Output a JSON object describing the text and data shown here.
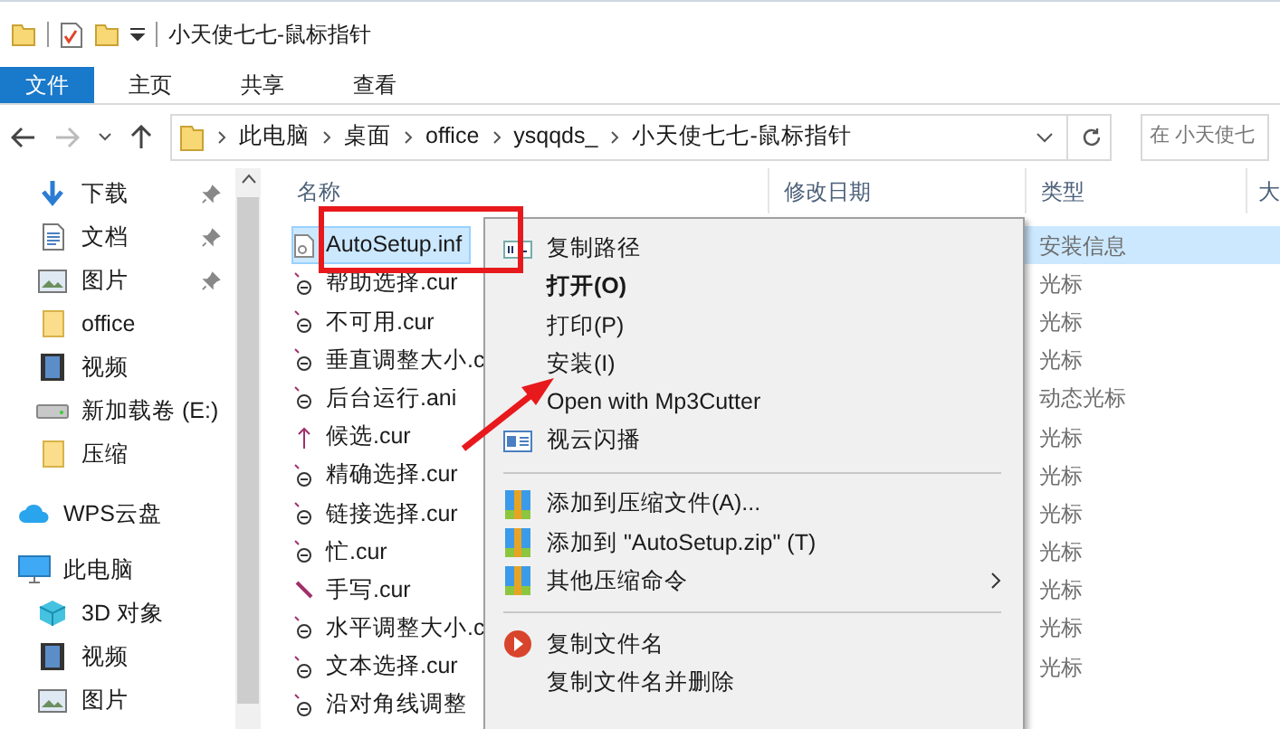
{
  "window": {
    "title": "小天使七七-鼠标指针"
  },
  "ribbon_tabs": [
    {
      "label": "文件",
      "selected": true
    },
    {
      "label": "主页",
      "selected": false
    },
    {
      "label": "共享",
      "selected": false
    },
    {
      "label": "查看",
      "selected": false
    }
  ],
  "address_bar": {
    "breadcrumbs": [
      "此电脑",
      "桌面",
      "office",
      "ysqqds_",
      "小天使七七-鼠标指针"
    ],
    "search_placeholder": "在 小天使七"
  },
  "sidebar": {
    "quick_access": [
      {
        "label": "下载",
        "kind": "download",
        "pinned": true
      },
      {
        "label": "文档",
        "kind": "document",
        "pinned": true
      },
      {
        "label": "图片",
        "kind": "picture",
        "pinned": true
      },
      {
        "label": "office",
        "kind": "folder",
        "pinned": false
      },
      {
        "label": "视频",
        "kind": "video",
        "pinned": false
      },
      {
        "label": "新加载卷 (E:)",
        "kind": "drive",
        "pinned": false
      },
      {
        "label": "压缩",
        "kind": "folder",
        "pinned": false
      }
    ],
    "tree": [
      {
        "label": "WPS云盘",
        "kind": "cloud"
      },
      {
        "label": "此电脑",
        "kind": "pc",
        "children": [
          {
            "label": "3D 对象",
            "kind": "cube"
          },
          {
            "label": "视频",
            "kind": "video"
          },
          {
            "label": "图片",
            "kind": "picture"
          }
        ]
      }
    ]
  },
  "file_list": {
    "columns": [
      "名称",
      "修改日期",
      "类型",
      "大"
    ],
    "rows": [
      {
        "name": "AutoSetup.inf",
        "kind": "setup",
        "type": "安装信息",
        "selected": true
      },
      {
        "name": "帮助选择.cur",
        "kind": "cursor",
        "type": "光标",
        "selected": false
      },
      {
        "name": "不可用.cur",
        "kind": "cursor",
        "type": "光标",
        "selected": false
      },
      {
        "name": "垂直调整大小.c",
        "kind": "cursor",
        "type": "光标",
        "selected": false
      },
      {
        "name": "后台运行.ani",
        "kind": "cursor",
        "type": "动态光标",
        "selected": false
      },
      {
        "name": "候选.cur",
        "kind": "arrow",
        "type": "光标",
        "selected": false
      },
      {
        "name": "精确选择.cur",
        "kind": "cursor",
        "type": "光标",
        "selected": false
      },
      {
        "name": "链接选择.cur",
        "kind": "cursor",
        "type": "光标",
        "selected": false
      },
      {
        "name": "忙.cur",
        "kind": "cursor",
        "type": "光标",
        "selected": false
      },
      {
        "name": "手写.cur",
        "kind": "pen",
        "type": "光标",
        "selected": false
      },
      {
        "name": "水平调整大小.c",
        "kind": "cursor",
        "type": "光标",
        "selected": false
      },
      {
        "name": "文本选择.cur",
        "kind": "cursor",
        "type": "光标",
        "selected": false
      },
      {
        "name": "沿对角线调整",
        "kind": "cursor",
        "selected": false
      }
    ]
  },
  "context_menu": {
    "items": [
      {
        "kind": "path",
        "label": "复制路径",
        "default": false,
        "submenu": false
      },
      {
        "kind": "plain",
        "label": "打开(O)",
        "default": true,
        "submenu": false
      },
      {
        "kind": "plain",
        "label": "打印(P)",
        "default": false,
        "submenu": false
      },
      {
        "kind": "plain",
        "label": "安装(I)",
        "default": false,
        "submenu": false
      },
      {
        "kind": "plain",
        "label": "Open with Mp3Cutter",
        "default": false,
        "submenu": false
      },
      {
        "kind": "window",
        "label": "视云闪播",
        "default": false,
        "submenu": false
      },
      {
        "kind": "separator"
      },
      {
        "kind": "archive",
        "label": "添加到压缩文件(A)...",
        "default": false,
        "submenu": false
      },
      {
        "kind": "archive",
        "label": "添加到 \"AutoSetup.zip\" (T)",
        "default": false,
        "submenu": false
      },
      {
        "kind": "archive",
        "label": "其他压缩命令",
        "default": false,
        "submenu": true
      },
      {
        "kind": "separator"
      },
      {
        "kind": "play",
        "label": "复制文件名",
        "default": false,
        "submenu": false
      },
      {
        "kind": "plain",
        "label": "复制文件名并删除",
        "default": false,
        "submenu": false
      }
    ]
  }
}
